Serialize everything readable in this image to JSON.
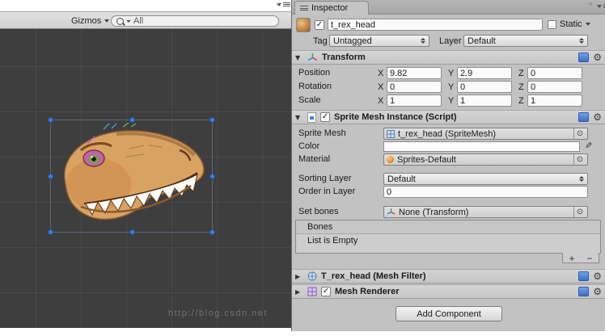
{
  "watermark": "http://blog.csdn.net",
  "scene_view": {
    "gizmos_label": "Gizmos",
    "search_label": "All"
  },
  "inspector": {
    "tab_label": "Inspector",
    "header": {
      "name": "t_rex_head",
      "static_label": "Static",
      "tag_label": "Tag",
      "tag_value": "Untagged",
      "layer_label": "Layer",
      "layer_value": "Default"
    },
    "transform": {
      "title": "Transform",
      "axis_labels": [
        "X",
        "Y",
        "Z"
      ],
      "rows": [
        {
          "label": "Position",
          "x": "9.82",
          "y": "2.9",
          "z": "0"
        },
        {
          "label": "Rotation",
          "x": "0",
          "y": "0",
          "z": "0"
        },
        {
          "label": "Scale",
          "x": "1",
          "y": "1",
          "z": "1"
        }
      ]
    },
    "sprite_mesh_instance": {
      "title": "Sprite Mesh Instance (Script)",
      "sprite_mesh_label": "Sprite Mesh",
      "sprite_mesh_value": "t_rex_head (SpriteMesh)",
      "color_label": "Color",
      "material_label": "Material",
      "material_value": "Sprites-Default",
      "sorting_layer_label": "Sorting Layer",
      "sorting_layer_value": "Default",
      "order_in_layer_label": "Order in Layer",
      "order_in_layer_value": "0",
      "set_bones_label": "Set bones",
      "set_bones_value": "None (Transform)",
      "bones_header": "Bones",
      "bones_empty": "List is Empty",
      "add_button": "+",
      "remove_button": "−"
    },
    "mesh_filter": {
      "title": "T_rex_head (Mesh Filter)"
    },
    "mesh_renderer": {
      "title": "Mesh Renderer"
    },
    "add_component_label": "Add Component"
  }
}
